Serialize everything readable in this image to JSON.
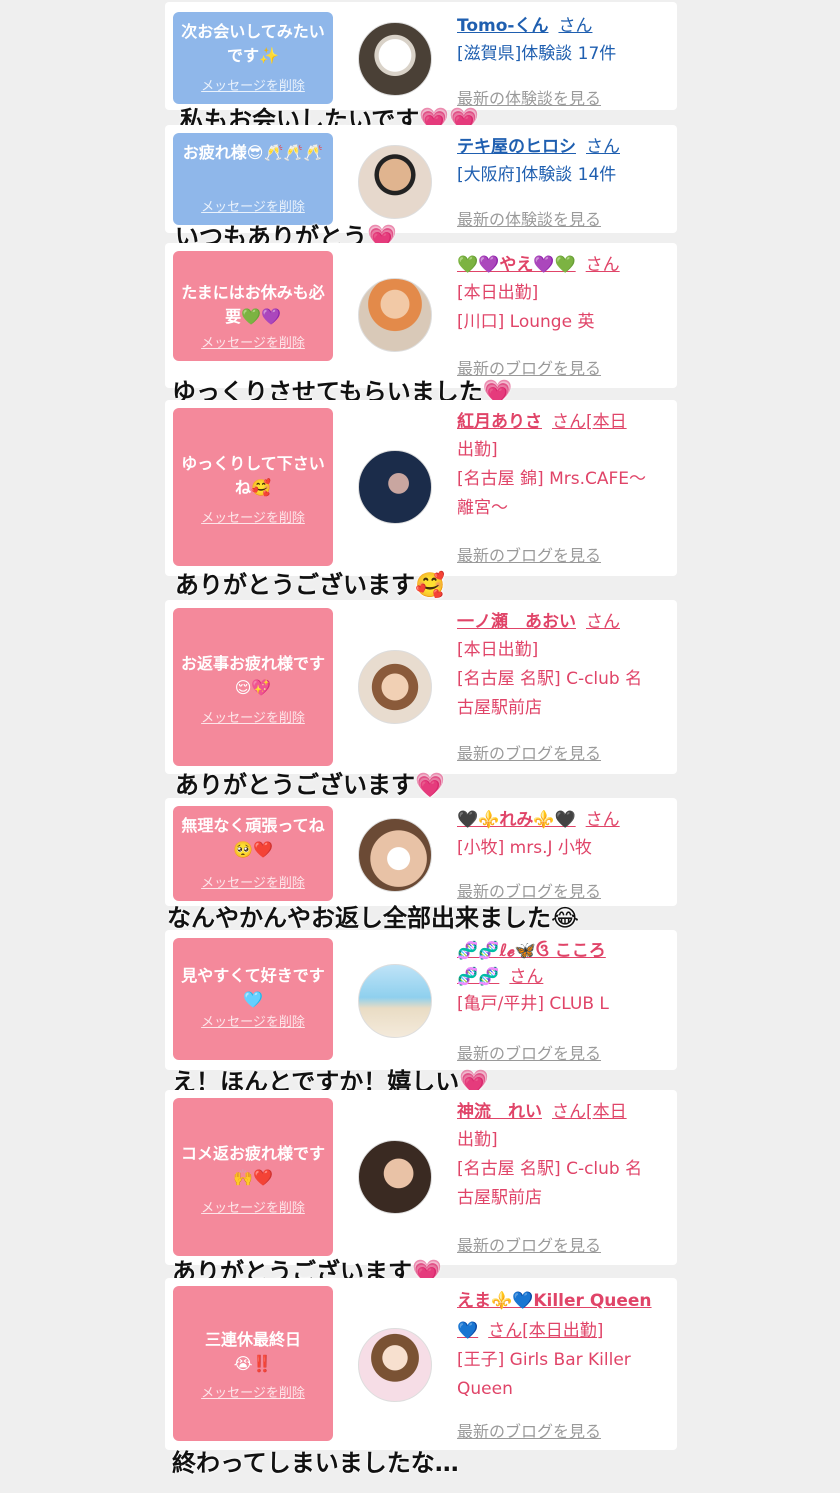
{
  "cards": [
    {
      "message": "次お会いしてみたいです✨",
      "delete_label": "メッセージを削除",
      "name": "Tomo-くん",
      "san": "さん",
      "lines": [
        "[滋賀県]体験談 17件"
      ],
      "more_label": "最新の体験談を見る",
      "caption": "私もお会いしたいです💗💗"
    },
    {
      "message": "お疲れ様😎🥂🥂🥂",
      "delete_label": "メッセージを削除",
      "name": "テキ屋のヒロシ",
      "san": "さん",
      "lines": [
        "[大阪府]体験談 14件"
      ],
      "more_label": "最新の体験談を見る",
      "caption": "いつもありがとう💗"
    },
    {
      "message": "たまにはお休みも必要💚💜",
      "delete_label": "メッセージを削除",
      "name": "💚💜やえ💜💚",
      "san": "さん",
      "lines": [
        "[本日出勤]",
        "[川口] Lounge 英"
      ],
      "more_label": "最新のブログを見る",
      "caption": "ゆっくりさせてもらいました💗"
    },
    {
      "message": "ゆっくりして下さいね🥰",
      "delete_label": "メッセージを削除",
      "name": "紅月ありさ",
      "san": "さん[本日",
      "lines": [
        "出勤]",
        "[名古屋 錦] Mrs.CAFE〜",
        "離宮〜"
      ],
      "more_label": "最新のブログを見る",
      "caption": "ありがとうございます🥰"
    },
    {
      "message": "お返事お疲れ様です😌💖",
      "delete_label": "メッセージを削除",
      "name": "一ノ瀬　あおい",
      "san": "さん",
      "lines": [
        "[本日出勤]",
        "[名古屋 名駅] C-club 名",
        "古屋駅前店"
      ],
      "more_label": "最新のブログを見る",
      "caption": "ありがとうございます💗"
    },
    {
      "message": "無理なく頑張ってね🥺❤️",
      "delete_label": "メッセージを削除",
      "name": "🖤⚜️れみ⚜️🖤",
      "san": "さん",
      "lines": [
        "[小牧] mrs.J 小牧"
      ],
      "more_label": "最新のブログを見る",
      "caption": "なんやかんやお返し全部出来ました😂"
    },
    {
      "message": "見やすくて好きです🩵",
      "delete_label": "メッセージを削除",
      "name": "🧬🧬ℓ𝓮🦋ઉ こころ",
      "name2": "🧬🧬",
      "san": "さん",
      "lines": [
        "[亀戸/平井] CLUB L"
      ],
      "more_label": "最新のブログを見る",
      "caption": "え！ほんとですか！嬉しい💗"
    },
    {
      "message": "コメ返お疲れ様です🙌❤️",
      "delete_label": "メッセージを削除",
      "name": "神流　れい",
      "san": "さん[本日",
      "lines": [
        "出勤]",
        "[名古屋 名駅] C-club 名",
        "古屋駅前店"
      ],
      "more_label": "最新のブログを見る",
      "caption": "ありがとうございます💗"
    },
    {
      "message": "三連休最終日😭‼️",
      "delete_label": "メッセージを削除",
      "name": "えま⚜️💙Killer Queen",
      "name2": "💙",
      "san": "さん[本日出勤]",
      "lines": [
        "[王子] Girls Bar Killer",
        "Queen"
      ],
      "more_label": "最新のブログを見る",
      "caption": "終わってしまいましたな…"
    }
  ]
}
